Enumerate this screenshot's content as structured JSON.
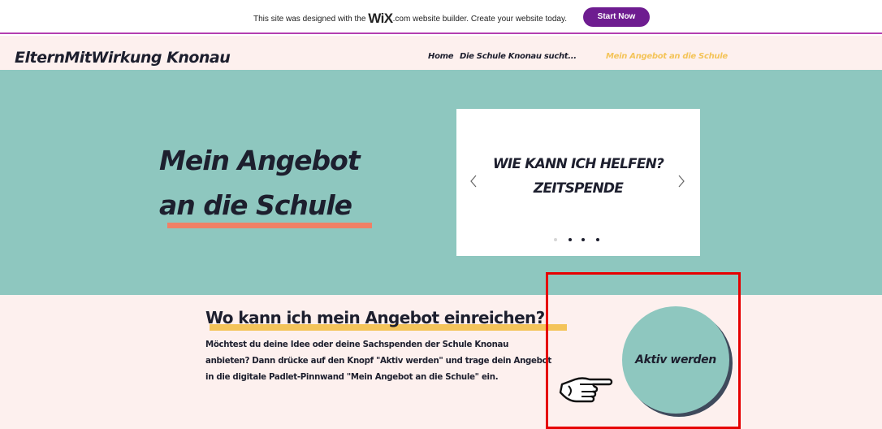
{
  "wix_banner": {
    "text_before": "This site was designed with the ",
    "logo": "WiX",
    "text_after": ".com website builder. Create your website today.",
    "button_label": "Start Now"
  },
  "header": {
    "site_title": "ElternMitWirkung Knonau",
    "nav": [
      {
        "label": "Home",
        "active": false
      },
      {
        "label": "Die Schule Knonau sucht...",
        "active": false
      },
      {
        "label": "Mein Angebot an die Schule",
        "active": true
      }
    ]
  },
  "hero": {
    "title_line1": "Mein Angebot",
    "title_line2": "an die Schule",
    "slider": {
      "line1": "WIE KANN ICH HELFEN?",
      "line2": "ZEITSPENDE",
      "prev_icon": "chevron-left-icon",
      "next_icon": "chevron-right-icon",
      "slide_count": 4,
      "active_slide": 2
    }
  },
  "section": {
    "title": "Wo kann ich mein Angebot einreichen?",
    "body": "Möchtest du deine Idee oder deine Sachspenden der Schule Knonau anbieten? Dann drücke auf den Knopf \"Aktiv werden\" und trage dein Angebot in die digitale Padlet-Pinnwand \"Mein Angebot an die Schule\" ein.",
    "cta_label": "Aktiv werden",
    "pointer_icon": "pointing-hand-icon"
  },
  "colors": {
    "teal": "#8ec7bf",
    "blush": "#fdf0ee",
    "navy": "#1d1f2e",
    "coral": "#f08066",
    "yellow": "#f4c45a",
    "wix_purple": "#6e1c90",
    "highlight_red": "#e60000"
  }
}
